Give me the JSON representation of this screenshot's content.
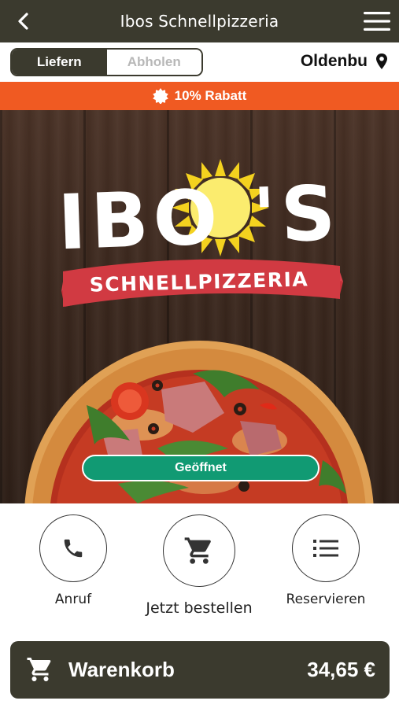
{
  "header": {
    "title": "Ibos Schnellpizzeria",
    "back_icon": "chevron-left-icon",
    "menu_icon": "hamburger-menu-icon"
  },
  "mode_toggle": {
    "options": [
      {
        "label": "Liefern",
        "active": true
      },
      {
        "label": "Abholen",
        "active": false
      }
    ]
  },
  "location": {
    "text": "Oldenbu",
    "icon": "map-pin-icon"
  },
  "discount": {
    "label": "10% Rabatt",
    "icon": "badge-icon",
    "color": "#f05a22"
  },
  "hero": {
    "logo_main": "IBO'S",
    "logo_sub": "SCHNELLPIZZERIA",
    "status": "Geöffnet",
    "status_color": "#119a73"
  },
  "actions": [
    {
      "label": "Anruf",
      "icon": "phone-icon"
    },
    {
      "label": "Jetzt bestellen",
      "icon": "shopping-cart-icon"
    },
    {
      "label": "Reservieren",
      "icon": "list-icon"
    }
  ],
  "cart": {
    "label": "Warenkorb",
    "total": "34,65 €",
    "icon": "shopping-cart-icon"
  },
  "colors": {
    "primary": "#3b3a2e",
    "accent": "#f05a22"
  }
}
